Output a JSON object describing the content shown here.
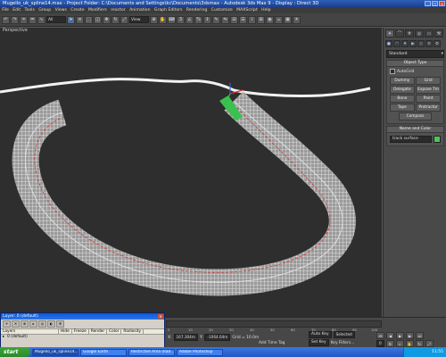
{
  "window": {
    "title": "Mugello_uk_spline14.max  -  Project Folder: C:\\Documents and Settings\\kc\\Documents\\3dsmax  -  Autodesk 3ds Max 9  -  Display : Direct 3D"
  },
  "menu": [
    "File",
    "Edit",
    "Tools",
    "Group",
    "Views",
    "Create",
    "Modifiers",
    "reactor",
    "Animation",
    "Graph Editors",
    "Rendering",
    "Customize",
    "MAXScript",
    "Help"
  ],
  "toolbar": {
    "selection_filter": "All",
    "coord_system": "View"
  },
  "viewport": {
    "label": "Perspective"
  },
  "command_panel": {
    "category": "Standard",
    "object_type_header": "Object Type",
    "autogrid": "AutoGrid",
    "objects": [
      "Dummy",
      "Grid",
      "Delegate",
      "Expose Tm",
      "Bone",
      "Point",
      "Tape",
      "Protractor",
      "Compass"
    ],
    "name_header": "Name and Color",
    "name_value": "track surface",
    "name_color": "#4cc45a"
  },
  "time_ticks": [
    "0",
    "10",
    "20",
    "30",
    "40",
    "50",
    "60",
    "70",
    "80",
    "90",
    "100"
  ],
  "status": {
    "x_label": "X:",
    "x_value": "167.304m",
    "y_label": "Y:",
    "y_value": "-1064.64m",
    "grid": "Grid = 10.0m",
    "add_time_tag": "Add Time Tag",
    "auto_key": "Auto Key",
    "selected": "Selected",
    "set_key": "Set Key",
    "key_filters": "Key Filters...",
    "frame": "0"
  },
  "layers": {
    "title": "Layer: 0 (default)",
    "columns": [
      "Layers",
      "Hide",
      "Freeze",
      "Render",
      "Color",
      "Radiosity"
    ],
    "rows": [
      "0 (default)"
    ]
  },
  "taskbar": {
    "start": "start",
    "tasks": [
      "Mugello_uk_spline14....",
      "Google Earth",
      "Restricted Area (Rad...",
      "Adobe Photoshop"
    ],
    "clock": "11:55"
  }
}
